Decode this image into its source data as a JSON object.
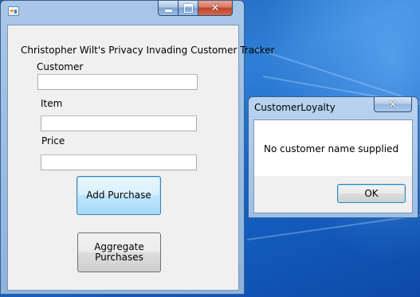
{
  "main_window": {
    "caption_buttons": {
      "minimize_icon": "minimize-icon",
      "maximize_icon": "maximize-icon",
      "close_icon": "close-icon"
    },
    "form_title": "Christopher Wilt's Privacy Invading Customer Tracker",
    "fields": {
      "customer_label": "Customer",
      "customer_value": "",
      "item_label": "Item",
      "item_value": "",
      "price_label": "Price",
      "price_value": ""
    },
    "buttons": {
      "add_purchase": "Add Purchase",
      "aggregate_line1": "Aggregate",
      "aggregate_line2": "Purchases"
    }
  },
  "dialog": {
    "title": "CustomerLoyalty",
    "message": "No customer name supplied",
    "ok_label": "OK"
  },
  "colors": {
    "desktop": "#1a5fb4",
    "frame": "#a9c7e8",
    "focus_button": "#3c7fb1",
    "close_red": "#c2432a"
  }
}
